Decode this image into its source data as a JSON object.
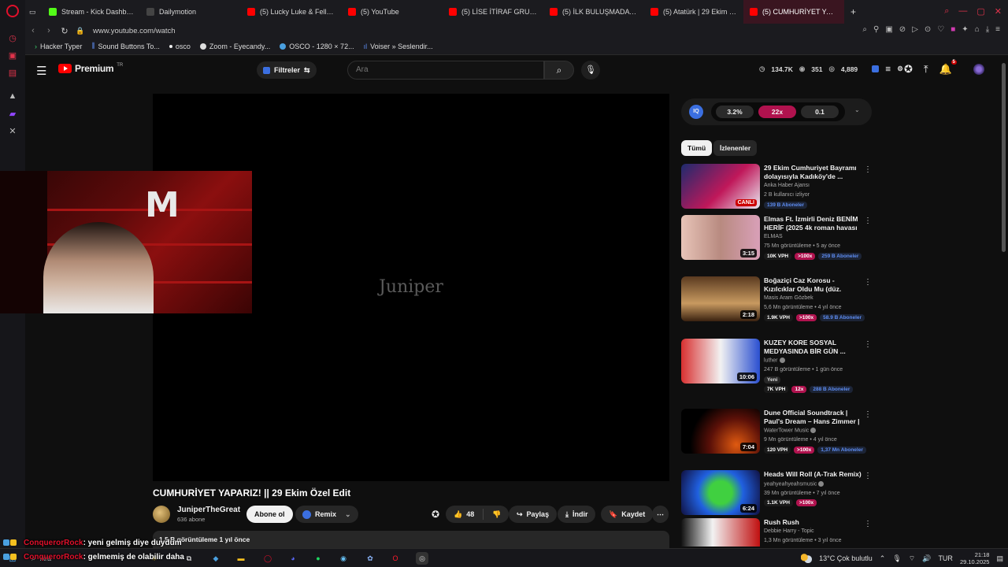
{
  "browser": {
    "tabs": [
      {
        "label": "Stream - Kick Dashboard",
        "color": "#53fc18"
      },
      {
        "label": "Dailymotion",
        "color": "#bbbbbb"
      },
      {
        "label": "(5) Lucky Luke & Fella - S",
        "color": "#ff0000"
      },
      {
        "label": "(5) YouTube",
        "color": "#ff0000"
      },
      {
        "label": "(5) LİSE İTİRAF GRUPLAR",
        "color": "#ff0000"
      },
      {
        "label": "(5) İLK BULUŞMADA YAP",
        "color": "#ff0000"
      },
      {
        "label": "(5) Atatürk | 29 Ekim Edit",
        "color": "#ff0000"
      },
      {
        "label": "(5) CUMHURİYET YAPARI",
        "color": "#ff0000",
        "active": true
      }
    ],
    "new_tab": "+",
    "url": "www.youtube.com/watch",
    "bookmarks": [
      {
        "label": "Hacker Typer",
        "icon": "chevron-icon"
      },
      {
        "label": "Sound Buttons To...",
        "icon": "bars-icon"
      },
      {
        "label": "osco",
        "icon": "dot-icon"
      },
      {
        "label": "Zoom - Eyecandy...",
        "icon": "globe-icon"
      },
      {
        "label": "OSCO - 1280 × 72...",
        "icon": "circle-icon"
      },
      {
        "label": "Voiser » Seslendir...",
        "icon": "wave-icon"
      }
    ]
  },
  "yt": {
    "logo_text": "Premium",
    "country": "TR",
    "filters_label": "Filtreler",
    "search_placeholder": "Ara",
    "stats": {
      "views": "134.7K",
      "watching": "351",
      "likes": "4,889"
    },
    "notif_count": "5"
  },
  "video": {
    "watermark": "Juniper",
    "title": "CUMHURİYET YAPARIZ! || 29 Ekim Özel Edit",
    "channel": "JuniperTheGreat",
    "subs": "636 abone",
    "subscribe": "Abone ol",
    "remix": "Remix",
    "likes": "48",
    "share": "Paylaş",
    "download": "İndir",
    "save": "Kaydet",
    "views_line": "1,5 B görüntüleme  1 yıl önce"
  },
  "sidebar": {
    "stat_chips": [
      "3.2%",
      "22x",
      "0.1"
    ],
    "chips": [
      "Tümü",
      "İzlenenler"
    ],
    "recs": [
      {
        "title": "29 Ekim Cumhuriyet Bayramı dolayısıyla Kadıköy'de ...",
        "channel": "Anka Haber Ajansı",
        "meta": "2 B kullanıcı izliyor",
        "badge": "CANLI",
        "tags": [
          {
            "t": "139 B Aboneler",
            "k": "subs"
          }
        ],
        "thumb": "linear-gradient(135deg,#1d2b6e,#c0185a 55%,#e8e8f0)"
      },
      {
        "title": "Elmas Ft. İzmirli Deniz BENİM HERİF (2025 4k roman havası ...",
        "channel": "ELMAS",
        "meta": "75 Mn görüntüleme • 5 ay önce",
        "badge": "3:15",
        "tags": [
          {
            "t": "10K VPH",
            "k": "vph"
          },
          {
            "t": ">100x",
            "k": "mult"
          },
          {
            "t": "259 B Aboneler",
            "k": "subs"
          }
        ],
        "thumb": "linear-gradient(90deg,#e8c4b8,#b88a80 50%,#d9a0b8)"
      },
      {
        "title": "Boğaziçi Caz Korosu - Kızılcıklar Oldu Mu (düz. Hakan Önsöz)",
        "channel": "Masis Aram Gözbek",
        "meta": "5,6 Mn görüntüleme • 4 yıl önce",
        "badge": "2:18",
        "tags": [
          {
            "t": "1.9K VPH",
            "k": "vph"
          },
          {
            "t": ">100x",
            "k": "mult"
          },
          {
            "t": "58.9 B Aboneler",
            "k": "subs"
          }
        ],
        "thumb": "linear-gradient(180deg,#5a3a20,#c89a60 60%,#3a2210)"
      },
      {
        "title": "KUZEY KORE SOSYAL MEDYASINDA BİR GÜN ...",
        "channel": "luther",
        "meta": "247 B görüntüleme • 1 gün önce",
        "badge": "10:06",
        "extra": "Yeni",
        "tags": [
          {
            "t": "7K VPH",
            "k": "vph"
          },
          {
            "t": "12x",
            "k": "mult"
          },
          {
            "t": "288 B Aboneler",
            "k": "subs"
          }
        ],
        "thumb": "linear-gradient(90deg,#d83030,#f2f2f2 50%,#2a4fd0)"
      },
      {
        "title": "Dune Official Soundtrack | Paul's Dream – Hans Zimmer | ...",
        "channel": "WaterTower Music",
        "meta": "9 Mn görüntüleme • 4 yıl önce",
        "badge": "7:04",
        "tags": [
          {
            "t": "120 VPH",
            "k": "vph"
          },
          {
            "t": ">100x",
            "k": "mult"
          },
          {
            "t": "1,37 Mn Aboneler",
            "k": "subs"
          }
        ],
        "thumb": "radial-gradient(circle at 70% 80%,#e05a10,#5a1008 40%,#000 70%)"
      },
      {
        "title": "Heads Will Roll (A-Trak Remix)",
        "channel": "yeahyeahyeahsmusic",
        "meta": "39 Mn görüntüleme • 7 yıl önce",
        "badge": "6:24",
        "tags": [
          {
            "t": "1.1K VPH",
            "k": "vph"
          },
          {
            "t": ">100x",
            "k": "mult"
          }
        ],
        "thumb": "radial-gradient(circle at 50% 50%,#40d040 25%,#2060e0 50%,#101040)"
      },
      {
        "title": "Rush Rush",
        "channel": "Debbie Harry - Topic",
        "meta": "1,3 Mn görüntüleme • 3 yıl önce",
        "badge": "",
        "tags": [],
        "thumb": "linear-gradient(90deg,#111,#f2f2f2 40%,#c01010)"
      }
    ]
  },
  "chat": [
    {
      "user": "ConquerorRock",
      "msg": ": yeni gelmiş diye duydum"
    },
    {
      "user": "ConquerorRock",
      "msg": ": gelmemiş de olabilir daha"
    }
  ],
  "taskbar": {
    "search_label": "Ara",
    "weather": "13°C  Çok bulutlu",
    "lang": "TUR",
    "time": "21:18",
    "date": "29.10.2025"
  }
}
